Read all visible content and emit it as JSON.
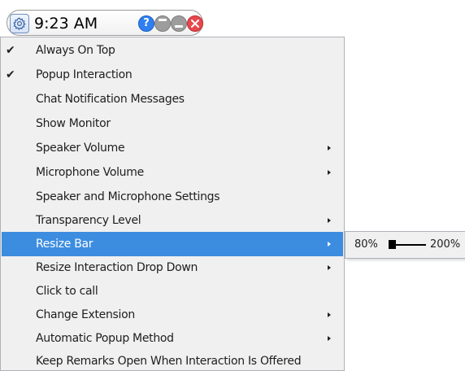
{
  "titlebar": {
    "time": "9:23 AM",
    "help_label": "?",
    "icons": [
      "gear-icon",
      "help-icon",
      "maximize-icon",
      "minimize-icon",
      "close-icon"
    ]
  },
  "menu": {
    "items": [
      {
        "label": "Always On Top",
        "checked": true,
        "submenu": false
      },
      {
        "label": "Popup Interaction",
        "checked": true,
        "submenu": false
      },
      {
        "label": "Chat Notification Messages",
        "checked": false,
        "submenu": false
      },
      {
        "label": "Show Monitor",
        "checked": false,
        "submenu": false
      },
      {
        "label": "Speaker Volume",
        "checked": false,
        "submenu": true
      },
      {
        "label": "Microphone Volume",
        "checked": false,
        "submenu": true
      },
      {
        "label": "Speaker and Microphone Settings",
        "checked": false,
        "submenu": false
      },
      {
        "label": "Transparency Level",
        "checked": false,
        "submenu": true
      },
      {
        "label": "Resize Bar",
        "checked": false,
        "submenu": true,
        "active": true
      },
      {
        "label": "Resize Interaction Drop Down",
        "checked": false,
        "submenu": true
      },
      {
        "label": "Click to call",
        "checked": false,
        "submenu": false
      },
      {
        "label": "Change Extension",
        "checked": false,
        "submenu": true
      },
      {
        "label": "Automatic Popup Method",
        "checked": false,
        "submenu": true
      },
      {
        "label": "Keep Remarks Open When Interaction Is Offered",
        "checked": false,
        "submenu": false
      }
    ],
    "check_glyph": "✔"
  },
  "resize_submenu": {
    "min_label": "80%",
    "max_label": "200%",
    "slider_value_fraction": 0.0
  },
  "colors": {
    "highlight": "#3c8ddf",
    "menu_bg": "#f0f0f0",
    "help": "#2f7ff1",
    "close": "#e8474c",
    "window_buttons": "#9d9d9d"
  }
}
